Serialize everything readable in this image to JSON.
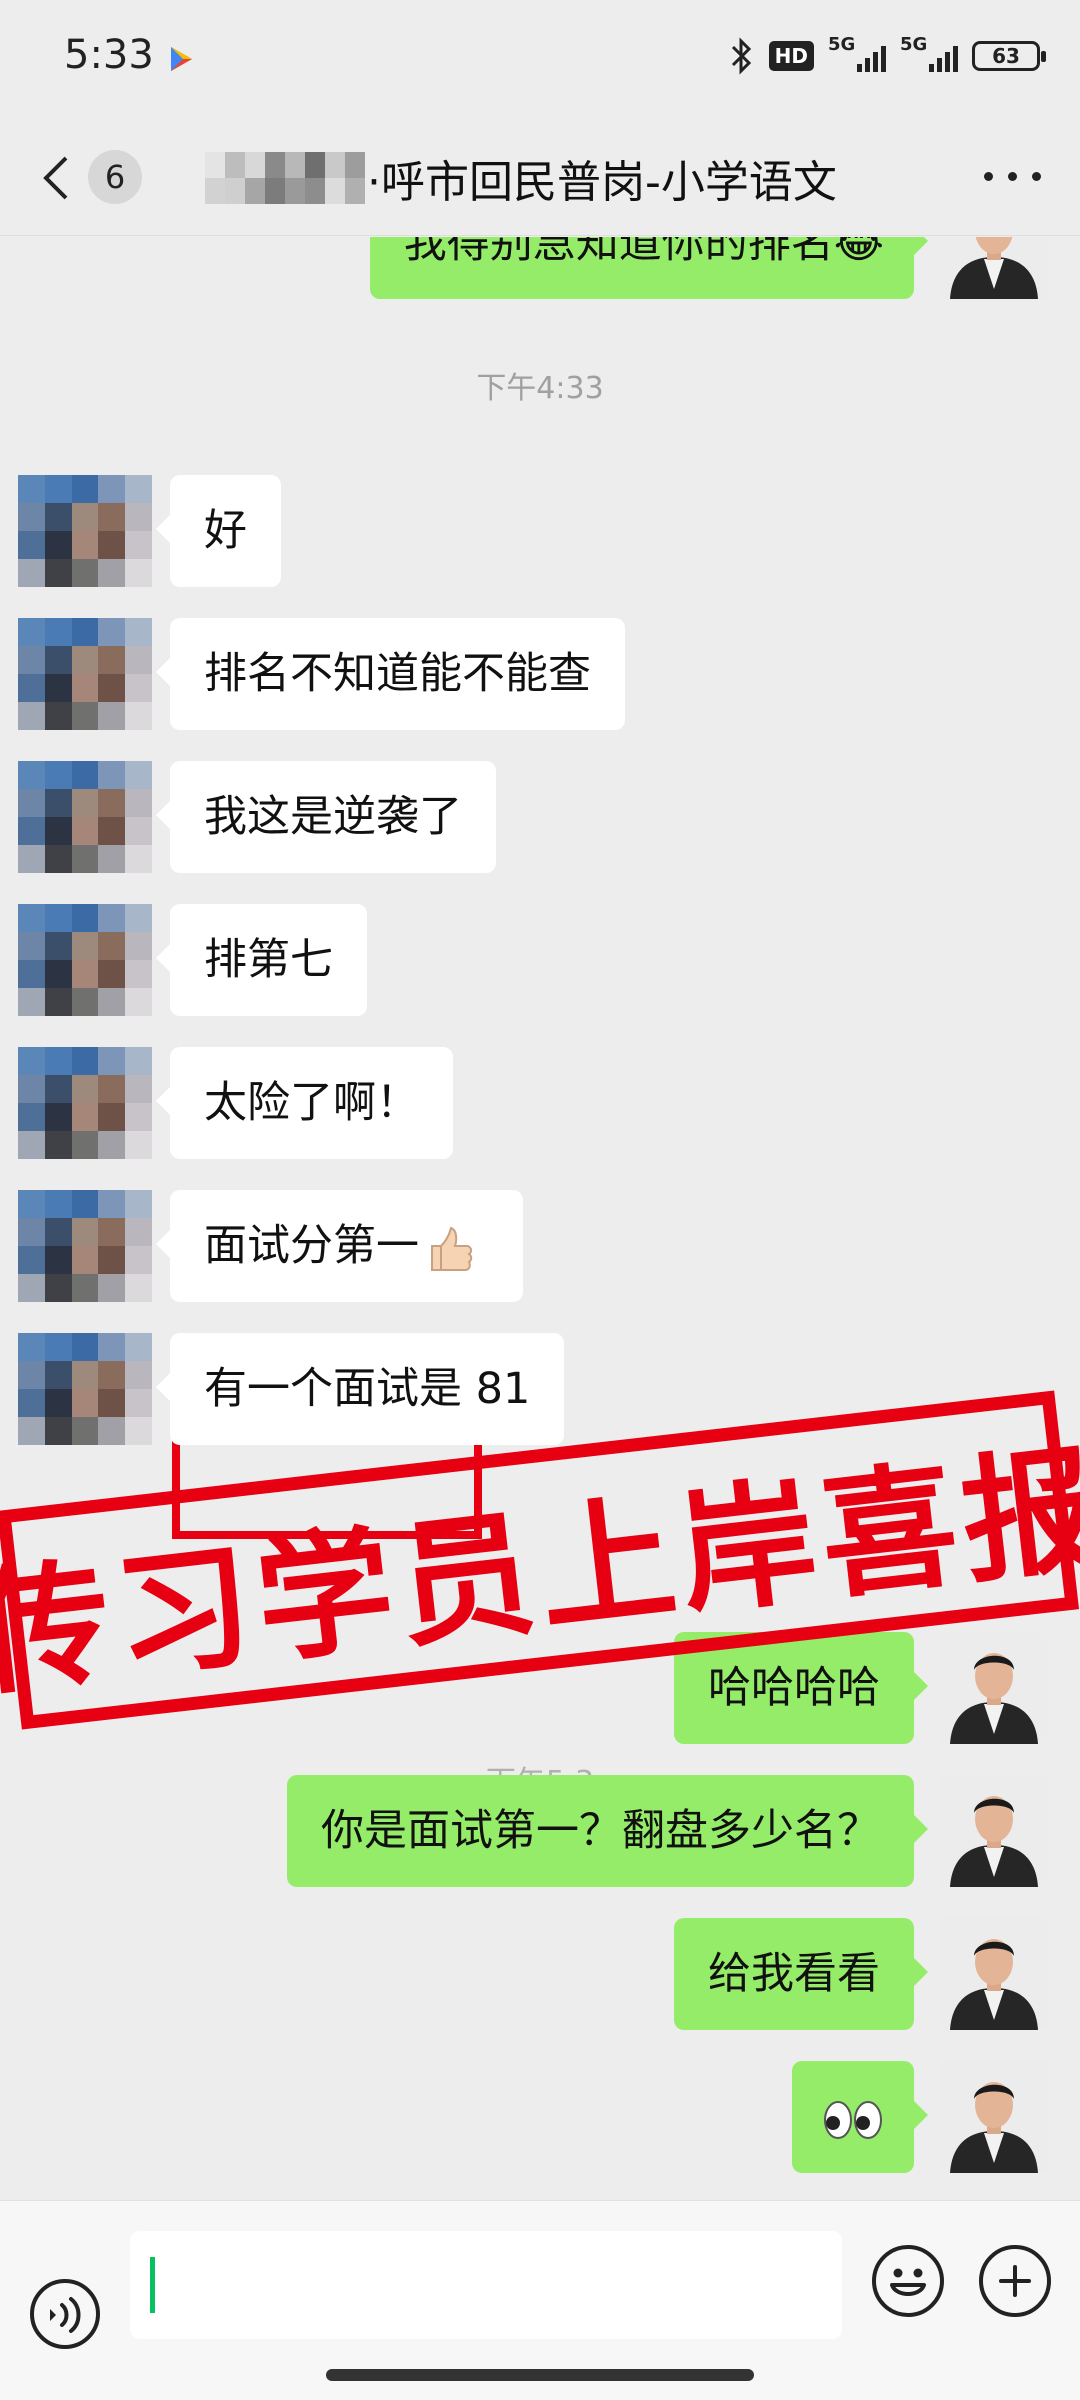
{
  "status_bar": {
    "time": "5:33",
    "network_hd": "HD",
    "network_1": "5G",
    "network_2": "5G",
    "battery": "63"
  },
  "header": {
    "unread_count": "6",
    "title": "·呼市回民普岗-小学语文",
    "more_icon": "more-dots-icon"
  },
  "chat": {
    "top_cut_message": "我得别急知道你的排名",
    "timestamp_1": "下午4:33",
    "incoming": [
      "好",
      "排名不知道能不能查",
      "我这是逆袭了",
      "排第七",
      "太险了啊！",
      "面试分第一",
      "有一个面试是 81"
    ],
    "timestamp_2": "下午5:3",
    "outgoing": [
      "哈哈哈哈",
      "你是面试第一？翻盘多少名？",
      "给我看看"
    ],
    "outgoing_emoji": "eyes-emoji"
  },
  "overlay": {
    "stamp_text": "传习学员上岸喜报",
    "stamp_color": "#e60012"
  },
  "input_bar": {
    "value": "",
    "voice_icon": "voice-icon",
    "emoji_icon": "emoji-icon",
    "plus_icon": "plus-icon"
  },
  "colors": {
    "outgoing_bubble": "#95ec69",
    "incoming_bubble": "#ffffff",
    "background": "#ededed",
    "highlight_box": "#e60012"
  }
}
